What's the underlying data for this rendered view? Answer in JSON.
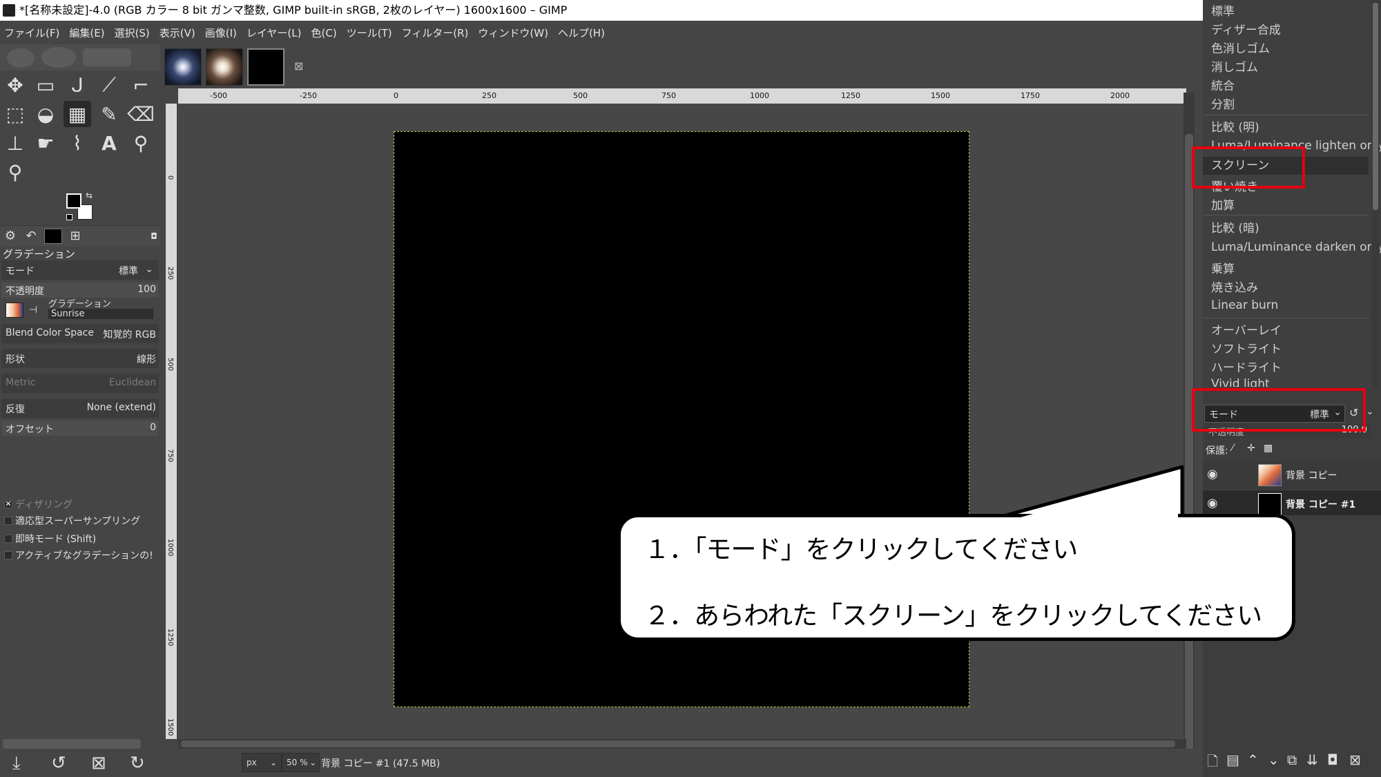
{
  "window": {
    "title": "*[名称未設定]-4.0 (RGB カラー 8 bit ガンマ整数, GIMP built-in sRGB, 2枚のレイヤー) 1600x1600 – GIMP"
  },
  "menubar": {
    "items": [
      "ファイル(F)",
      "編集(E)",
      "選択(S)",
      "表示(V)",
      "画像(I)",
      "レイヤー(L)",
      "色(C)",
      "ツール(T)",
      "フィルター(R)",
      "ウィンドウ(W)",
      "ヘルプ(H)"
    ]
  },
  "toolbox": {
    "tools": [
      "move-tool",
      "rect-select-tool",
      "lasso-tool",
      "fuzzy-select-tool",
      "crop-tool",
      "transform-tool",
      "bucket-fill-tool",
      "gradient-tool",
      "paintbrush-tool",
      "eraser-tool",
      "clone-tool",
      "smudge-tool",
      "paths-tool",
      "text-tool",
      "color-picker-tool",
      "zoom-tool"
    ],
    "text_tool_glyph": "A"
  },
  "tool_options": {
    "title": "グラデーション",
    "mode_label": "モード",
    "mode_value": "標準",
    "opacity_label": "不透明度",
    "opacity_value": "100",
    "gradient_label": "グラデーション",
    "gradient_value": "Sunrise",
    "blend_label": "Blend Color Space",
    "blend_value": "知覚的 RGB",
    "shape_label": "形状",
    "shape_value": "線形",
    "metric_label": "Metric",
    "metric_value": "Euclidean",
    "repeat_label": "反復",
    "repeat_value": "None (extend)",
    "offset_label": "オフセット",
    "offset_value": "0",
    "dither_label": "ディザリング",
    "adaptive_label": "適応型スーパーサンプリング",
    "instant_label": "即時モード  (Shift)",
    "active_label": "アクティブなグラデーションの!"
  },
  "canvas": {
    "ruler_ticks": [
      "-500",
      "-250",
      "0",
      "250",
      "500",
      "750",
      "1000",
      "1250",
      "1500",
      "1750",
      "2000"
    ],
    "vruler_ticks": [
      "0",
      "250",
      "500",
      "750",
      "1000",
      "1250",
      "1500"
    ]
  },
  "statusbar": {
    "unit": "px",
    "zoom": "50 %",
    "info": "背景 コピー #1 (47.5 MB)"
  },
  "mode_dropdown": {
    "items": [
      "標準",
      "ディザー合成",
      "色消しゴム",
      "消しゴム",
      "統合",
      "分割",
      "比較 (明)",
      "Luma/Luminance lighten only",
      "スクリーン",
      "覆い焼き",
      "加算",
      "比較 (暗)",
      "Luma/Luminance darken only",
      "乗算",
      "焼き込み",
      "Linear burn",
      "オーバーレイ",
      "ソフトライト",
      "ハードライト",
      "Vivid light"
    ],
    "selected": "スクリーン"
  },
  "layers": {
    "mode_label": "モード",
    "mode_value": "標準",
    "opacity_label": "不透明度",
    "opacity_value": "100.0",
    "lock_label": "保護:",
    "rows": [
      {
        "name": "背景 コピー",
        "selected": false
      },
      {
        "name": "背景 コピー #1",
        "selected": true
      }
    ]
  },
  "callout": {
    "line1": "１．「モード」をクリックしてください",
    "line2": "２．あらわれた「スクリーン」をクリックしてください"
  },
  "colors": {
    "highlight_red": "#e50012",
    "panel_bg": "#454545",
    "image_bg": "#000000"
  }
}
